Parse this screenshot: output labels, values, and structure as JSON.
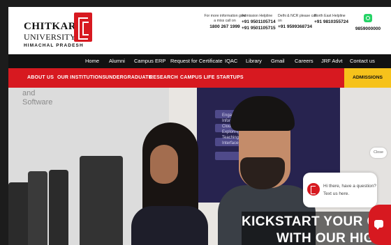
{
  "brand": {
    "name_line1": "CHITKARA",
    "name_line2": "UNIVERSITY",
    "name_line3": "HIMACHAL PRADESH",
    "color": "#d71920"
  },
  "contacts": [
    {
      "label": "For more information give a miss call on",
      "numbers": [
        "1800 267 1999"
      ]
    },
    {
      "label": "Admission Helpline",
      "numbers": [
        "+91 9501105714",
        "+91 9501105715"
      ]
    },
    {
      "label": "Delhi & NCR please call on",
      "numbers": [
        "+91 9599368734"
      ]
    },
    {
      "label": "North East Helpline",
      "numbers": [
        "+91 9810355724"
      ]
    },
    {
      "label": "",
      "icon": "whatsapp-icon",
      "numbers": [
        "9859000000"
      ]
    }
  ],
  "nav_black": [
    "Home",
    "Alumni",
    "Campus ERP",
    "Request for Certificate",
    "IQAC",
    "Library",
    "Gmail",
    "Careers",
    "JRF Advt",
    "Contact us"
  ],
  "nav_red": [
    "ABOUT US",
    "OUR INSTITUTIONS",
    "UNDERGRADUATE",
    "RESEARCH",
    "CAMPUS LIFE",
    "STARTUPS"
  ],
  "admissions_label": "ADMISSIONS",
  "hero": {
    "wall_text": "and\nSoftware",
    "screen_text": "Engaging\nInformation\nCloud, Anal\nExploring\nTeaching re\nInterfaces",
    "headline_line1": "KICKSTART YOUR CAREER",
    "headline_line2": "WITH OUR HIGHLY"
  },
  "chat": {
    "close_label": "Close",
    "message_line1": "Hi there, have a question?",
    "message_line2": "Text us here."
  },
  "colors": {
    "red": "#d71920",
    "black_nav": "#121212",
    "admissions": "#f6c21b"
  }
}
